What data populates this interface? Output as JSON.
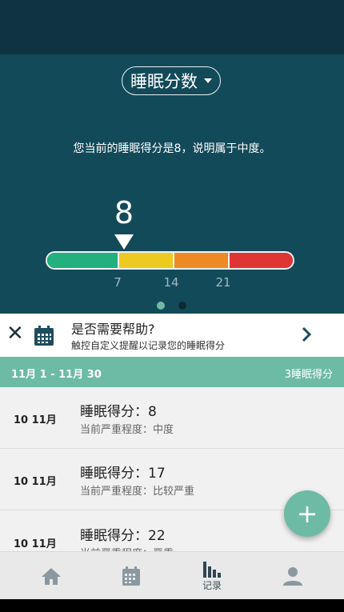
{
  "hero": {
    "selector_label": "睡眠分数",
    "description": "您当前的睡眠得分是8，说明属于中度。",
    "current_score": "8",
    "scale_ticks": [
      "7",
      "14",
      "21"
    ],
    "scale_colors": [
      "#22b07f",
      "#ecca1f",
      "#ee8a23",
      "#e03535"
    ],
    "page_indicator": {
      "count": 2,
      "active": 0
    }
  },
  "help_banner": {
    "title": "是否需要帮助?",
    "subtitle": "触控自定义提醒以记录您的睡眠得分"
  },
  "range_bar": {
    "date_range": "11月 1 - 11月 30",
    "summary": "3睡眠得分"
  },
  "records": [
    {
      "date": "10 11月",
      "score": "睡眠得分：8",
      "severity": "当前严重程度：中度"
    },
    {
      "date": "10 11月",
      "score": "睡眠得分：17",
      "severity": "当前严重程度：比较严重"
    },
    {
      "date": "10 11月",
      "score": "睡眠得分：22",
      "severity": "当前严重程度：严重"
    }
  ],
  "fab": {
    "icon": "plus-icon",
    "label": "+"
  },
  "nav": {
    "items": [
      {
        "icon": "home-icon",
        "label": ""
      },
      {
        "icon": "calendar-icon",
        "label": ""
      },
      {
        "icon": "bar-chart-icon",
        "label": "记录"
      },
      {
        "icon": "person-icon",
        "label": ""
      }
    ],
    "active": 2
  },
  "colors": {
    "accent": "#6dbba4",
    "hero_bg": "#134a5a",
    "top_bg": "#0f3340"
  }
}
